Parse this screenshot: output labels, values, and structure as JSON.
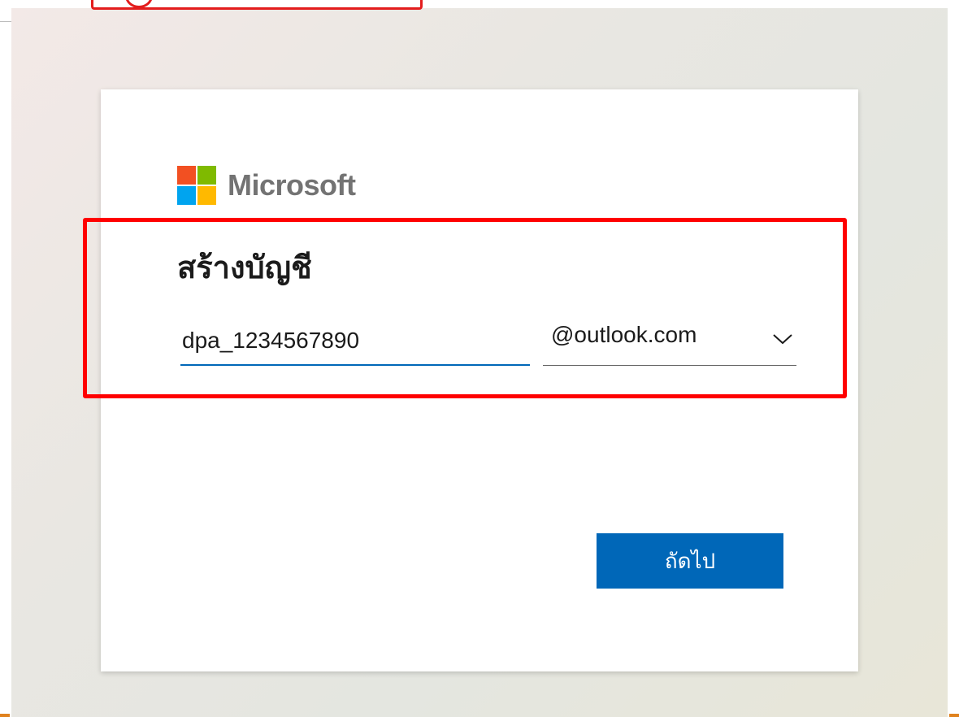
{
  "brand": {
    "name": "Microsoft",
    "logo_colors": [
      "#f25022",
      "#7fba00",
      "#00a4ef",
      "#ffb900"
    ]
  },
  "signup": {
    "heading": "สร้างบัญชี",
    "email_username": "dpa_1234567890",
    "domain_selected": "@outlook.com",
    "next_label": "ถัดไป"
  },
  "icons": {
    "logo": "microsoft-logo-icon",
    "dropdown": "chevron-down-icon"
  },
  "colors": {
    "primary": "#0067b8",
    "annotation": "#ff0000"
  }
}
